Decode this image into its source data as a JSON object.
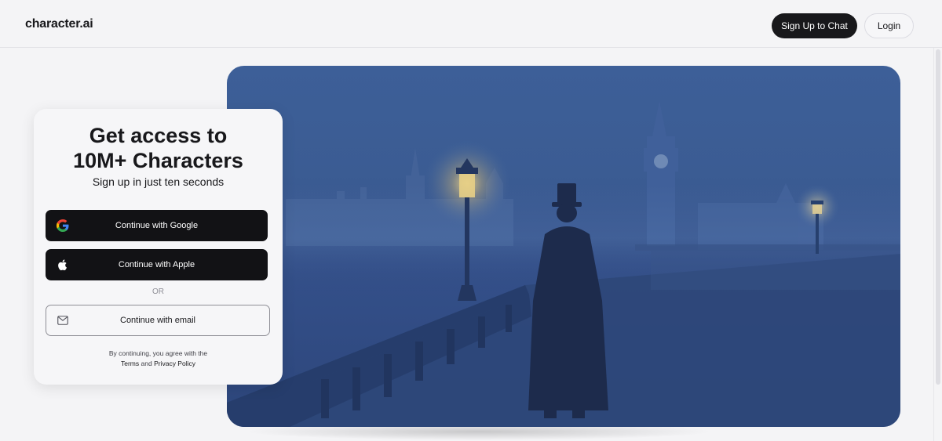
{
  "header": {
    "logo": "character.ai",
    "signup_label": "Sign Up to Chat",
    "login_label": "Login"
  },
  "card": {
    "title_line1": "Get access to",
    "title_line2": "10M+ Characters",
    "subtitle": "Sign up in just ten seconds",
    "google_label": "Continue with Google",
    "apple_label": "Continue with Apple",
    "or_label": "OR",
    "email_label": "Continue with email",
    "legal_prefix": "By continuing, you agree with the",
    "terms_label": "Terms",
    "and_label": "and",
    "privacy_label": "Privacy Policy"
  },
  "hero": {
    "description_icon": "foggy-london-bridge-image"
  },
  "colors": {
    "primary": "#18181b",
    "background": "#f4f4f6",
    "hero_blue": "#3b5c93"
  }
}
